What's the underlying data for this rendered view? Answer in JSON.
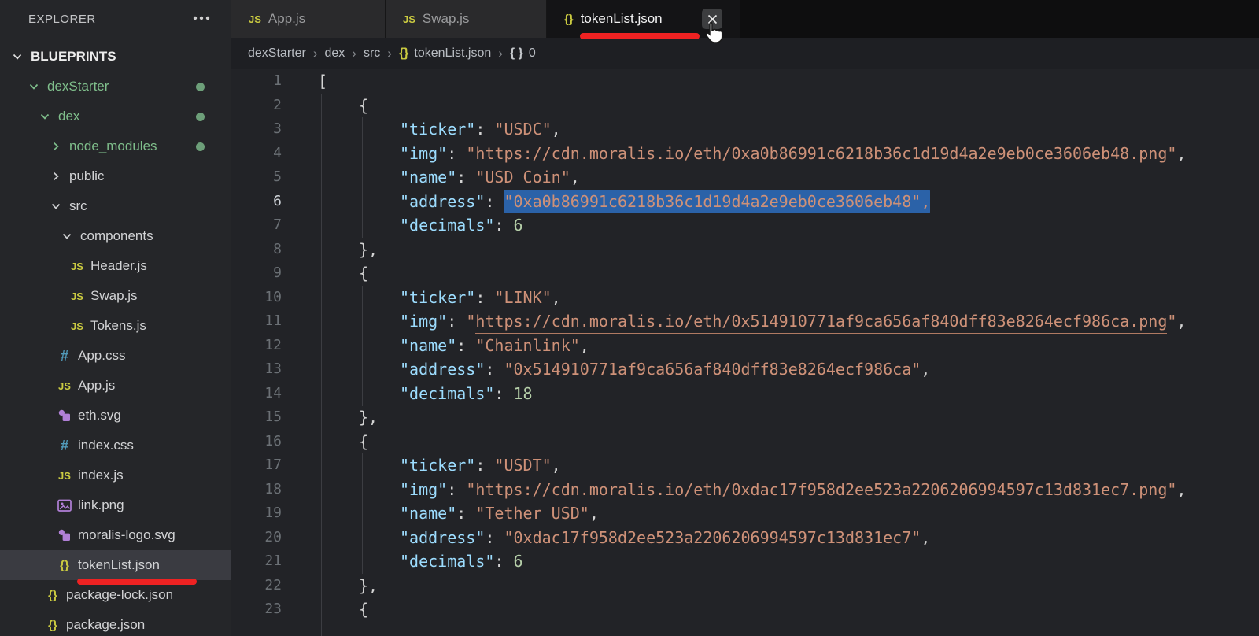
{
  "colors": {
    "annotation_red": "#ee2222",
    "selection_blue": "#2b62a8",
    "git_green_text": "#7fbe8b",
    "git_green_dot": "#6d9f79",
    "key_blue": "#9cdcfe",
    "string_salmon": "#ce9178",
    "number_green": "#b5cea8"
  },
  "sidebar": {
    "header": {
      "title": "EXPLORER",
      "menu_icon": "ellipsis-icon"
    },
    "section": {
      "label": "BLUEPRINTS",
      "icon": "chevron-down"
    },
    "items": [
      {
        "label": "dexStarter",
        "icon": "chevron-down",
        "indent": 33,
        "green": true,
        "dot": true
      },
      {
        "label": "dex",
        "icon": "chevron-down",
        "indent": 47,
        "green": true,
        "dot": true
      },
      {
        "label": "node_modules",
        "icon": "chevron-right",
        "indent": 61,
        "green": true,
        "dot": true
      },
      {
        "label": "public",
        "icon": "chevron-right",
        "indent": 61
      },
      {
        "label": "src",
        "icon": "chevron-down",
        "indent": 61
      },
      {
        "label": "components",
        "icon": "chevron-down",
        "indent": 75
      },
      {
        "label": "Header.js",
        "icon": "js",
        "indent": 88
      },
      {
        "label": "Swap.js",
        "icon": "js",
        "indent": 88
      },
      {
        "label": "Tokens.js",
        "icon": "js",
        "indent": 88
      },
      {
        "label": "App.css",
        "icon": "css",
        "indent": 72
      },
      {
        "label": "App.js",
        "icon": "js",
        "indent": 72
      },
      {
        "label": "eth.svg",
        "icon": "svg",
        "indent": 72
      },
      {
        "label": "index.css",
        "icon": "css",
        "indent": 72
      },
      {
        "label": "index.js",
        "icon": "js",
        "indent": 72
      },
      {
        "label": "link.png",
        "icon": "image",
        "indent": 72
      },
      {
        "label": "moralis-logo.svg",
        "icon": "svg",
        "indent": 72
      },
      {
        "label": "tokenList.json",
        "icon": "json",
        "indent": 72,
        "selected": true,
        "underline": true
      },
      {
        "label": "package-lock.json",
        "icon": "json",
        "indent": 57
      },
      {
        "label": "package.json",
        "icon": "json",
        "indent": 57
      }
    ]
  },
  "tabs": [
    {
      "label": "App.js",
      "icon": "js"
    },
    {
      "label": "Swap.js",
      "icon": "js"
    },
    {
      "label": "tokenList.json",
      "icon": "json",
      "active": true,
      "close": true,
      "underline": true
    }
  ],
  "breadcrumb": [
    {
      "label": "dexStarter"
    },
    {
      "label": "dex"
    },
    {
      "label": "src"
    },
    {
      "label": "tokenList.json",
      "icon": "json-yellow"
    },
    {
      "label": "0",
      "icon": "braces-gray"
    }
  ],
  "editor": {
    "active_line": 6,
    "lines": [
      {
        "n": 1,
        "ind": 0,
        "segs": [
          {
            "c": "pun",
            "t": "["
          }
        ]
      },
      {
        "n": 2,
        "ind": 1,
        "segs": [
          {
            "c": "pun",
            "t": "{"
          }
        ]
      },
      {
        "n": 3,
        "ind": 2,
        "segs": [
          {
            "c": "key",
            "t": "\"ticker\""
          },
          {
            "c": "pun",
            "t": ": "
          },
          {
            "c": "str",
            "t": "\"USDC\""
          },
          {
            "c": "pun",
            "t": ","
          }
        ]
      },
      {
        "n": 4,
        "ind": 2,
        "segs": [
          {
            "c": "key",
            "t": "\"img\""
          },
          {
            "c": "pun",
            "t": ": "
          },
          {
            "c": "str",
            "t": "\""
          },
          {
            "c": "url",
            "t": "https://cdn.moralis.io/eth/0xa0b86991c6218b36c1d19d4a2e9eb0ce3606eb48.png"
          },
          {
            "c": "str",
            "t": "\""
          },
          {
            "c": "pun",
            "t": ","
          }
        ]
      },
      {
        "n": 5,
        "ind": 2,
        "segs": [
          {
            "c": "key",
            "t": "\"name\""
          },
          {
            "c": "pun",
            "t": ": "
          },
          {
            "c": "str",
            "t": "\"USD Coin\""
          },
          {
            "c": "pun",
            "t": ","
          }
        ]
      },
      {
        "n": 6,
        "ind": 2,
        "segs": [
          {
            "c": "key",
            "t": "\"address\""
          },
          {
            "c": "pun",
            "t": ": "
          },
          {
            "c": "sel",
            "t": "\"0xa0b86991c6218b36c1d19d4a2e9eb0ce3606eb48\","
          }
        ]
      },
      {
        "n": 7,
        "ind": 2,
        "segs": [
          {
            "c": "key",
            "t": "\"decimals\""
          },
          {
            "c": "pun",
            "t": ": "
          },
          {
            "c": "num",
            "t": "6"
          }
        ]
      },
      {
        "n": 8,
        "ind": 1,
        "segs": [
          {
            "c": "pun",
            "t": "},"
          }
        ]
      },
      {
        "n": 9,
        "ind": 1,
        "segs": [
          {
            "c": "pun",
            "t": "{"
          }
        ]
      },
      {
        "n": 10,
        "ind": 2,
        "segs": [
          {
            "c": "key",
            "t": "\"ticker\""
          },
          {
            "c": "pun",
            "t": ": "
          },
          {
            "c": "str",
            "t": "\"LINK\""
          },
          {
            "c": "pun",
            "t": ","
          }
        ]
      },
      {
        "n": 11,
        "ind": 2,
        "segs": [
          {
            "c": "key",
            "t": "\"img\""
          },
          {
            "c": "pun",
            "t": ": "
          },
          {
            "c": "str",
            "t": "\""
          },
          {
            "c": "url",
            "t": "https://cdn.moralis.io/eth/0x514910771af9ca656af840dff83e8264ecf986ca.png"
          },
          {
            "c": "str",
            "t": "\""
          },
          {
            "c": "pun",
            "t": ","
          }
        ]
      },
      {
        "n": 12,
        "ind": 2,
        "segs": [
          {
            "c": "key",
            "t": "\"name\""
          },
          {
            "c": "pun",
            "t": ": "
          },
          {
            "c": "str",
            "t": "\"Chainlink\""
          },
          {
            "c": "pun",
            "t": ","
          }
        ]
      },
      {
        "n": 13,
        "ind": 2,
        "segs": [
          {
            "c": "key",
            "t": "\"address\""
          },
          {
            "c": "pun",
            "t": ": "
          },
          {
            "c": "str",
            "t": "\"0x514910771af9ca656af840dff83e8264ecf986ca\""
          },
          {
            "c": "pun",
            "t": ","
          }
        ]
      },
      {
        "n": 14,
        "ind": 2,
        "segs": [
          {
            "c": "key",
            "t": "\"decimals\""
          },
          {
            "c": "pun",
            "t": ": "
          },
          {
            "c": "num",
            "t": "18"
          }
        ]
      },
      {
        "n": 15,
        "ind": 1,
        "segs": [
          {
            "c": "pun",
            "t": "},"
          }
        ]
      },
      {
        "n": 16,
        "ind": 1,
        "segs": [
          {
            "c": "pun",
            "t": "{"
          }
        ]
      },
      {
        "n": 17,
        "ind": 2,
        "segs": [
          {
            "c": "key",
            "t": "\"ticker\""
          },
          {
            "c": "pun",
            "t": ": "
          },
          {
            "c": "str",
            "t": "\"USDT\""
          },
          {
            "c": "pun",
            "t": ","
          }
        ]
      },
      {
        "n": 18,
        "ind": 2,
        "segs": [
          {
            "c": "key",
            "t": "\"img\""
          },
          {
            "c": "pun",
            "t": ": "
          },
          {
            "c": "str",
            "t": "\""
          },
          {
            "c": "url",
            "t": "https://cdn.moralis.io/eth/0xdac17f958d2ee523a2206206994597c13d831ec7.png"
          },
          {
            "c": "str",
            "t": "\""
          },
          {
            "c": "pun",
            "t": ","
          }
        ]
      },
      {
        "n": 19,
        "ind": 2,
        "segs": [
          {
            "c": "key",
            "t": "\"name\""
          },
          {
            "c": "pun",
            "t": ": "
          },
          {
            "c": "str",
            "t": "\"Tether USD\""
          },
          {
            "c": "pun",
            "t": ","
          }
        ]
      },
      {
        "n": 20,
        "ind": 2,
        "segs": [
          {
            "c": "key",
            "t": "\"address\""
          },
          {
            "c": "pun",
            "t": ": "
          },
          {
            "c": "str",
            "t": "\"0xdac17f958d2ee523a2206206994597c13d831ec7\""
          },
          {
            "c": "pun",
            "t": ","
          }
        ]
      },
      {
        "n": 21,
        "ind": 2,
        "segs": [
          {
            "c": "key",
            "t": "\"decimals\""
          },
          {
            "c": "pun",
            "t": ": "
          },
          {
            "c": "num",
            "t": "6"
          }
        ]
      },
      {
        "n": 22,
        "ind": 1,
        "segs": [
          {
            "c": "pun",
            "t": "},"
          }
        ]
      },
      {
        "n": 23,
        "ind": 1,
        "segs": [
          {
            "c": "pun",
            "t": "{"
          }
        ]
      }
    ]
  }
}
